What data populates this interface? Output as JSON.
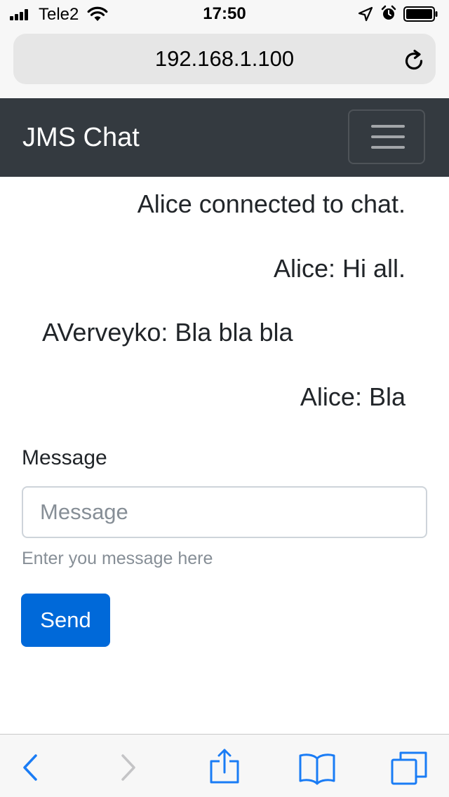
{
  "status_bar": {
    "carrier": "Tele2",
    "time": "17:50"
  },
  "browser": {
    "url": "192.168.1.100"
  },
  "navbar": {
    "brand": "JMS Chat"
  },
  "chat": {
    "messages": [
      {
        "text": "Alice connected to chat.",
        "align": "right"
      },
      {
        "text": "Alice: Hi all.",
        "align": "right"
      },
      {
        "text": "AVerveyko: Bla bla bla",
        "align": "left"
      },
      {
        "text": "Alice: Bla",
        "align": "right"
      }
    ]
  },
  "form": {
    "label": "Message",
    "input_value": "",
    "input_placeholder": "Message",
    "help_text": "Enter you message here",
    "send_label": "Send"
  },
  "icons": {
    "status": [
      "signal-icon",
      "wifi-icon",
      "location-icon",
      "alarm-icon",
      "battery-icon"
    ],
    "browser": [
      "reload-icon"
    ],
    "navbar": [
      "hamburger-icon"
    ],
    "toolbar": [
      "back-icon",
      "forward-icon",
      "share-icon",
      "bookmarks-icon",
      "tabs-icon"
    ]
  },
  "colors": {
    "navbar_bg": "#343a40",
    "primary": "#0069d9",
    "ios_blue": "#1a7cf5",
    "muted": "#868e96"
  }
}
